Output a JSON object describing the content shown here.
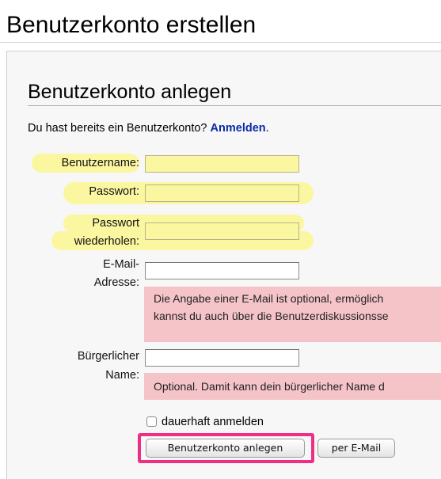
{
  "page": {
    "title": "Benutzerkonto erstellen"
  },
  "form": {
    "heading": "Benutzerkonto anlegen",
    "intro_text": "Du hast bereits ein Benutzerkonto? ",
    "login_link": "Anmelden",
    "intro_suffix": ".",
    "fields": {
      "username": {
        "label": "Benutzername:",
        "value": ""
      },
      "password": {
        "label": "Passwort:",
        "value": ""
      },
      "password_repeat": {
        "label_line1": "Passwort",
        "label_line2": "wiederholen:",
        "value": ""
      },
      "email": {
        "label_line1": "E-Mail-",
        "label_line2": "Adresse:",
        "value": "",
        "note_line1": "Die Angabe einer E-Mail ist optional, ermöglich",
        "note_line2": "kannst du auch über die Benutzerdiskussionsse"
      },
      "realname": {
        "label_line1": "Bürgerlicher",
        "label_line2": "Name:",
        "value": "",
        "note": "Optional. Damit kann dein bürgerlicher Name d"
      }
    },
    "remember": {
      "label": "dauerhaft anmelden",
      "checked": false
    },
    "buttons": {
      "create": "Benutzerkonto anlegen",
      "by_email": "per E-Mail"
    }
  },
  "colors": {
    "highlight": "#fbf7a0",
    "note_bg": "#f5c4c9",
    "link": "#0b2aa6",
    "button_outline": "#ef2f86"
  }
}
